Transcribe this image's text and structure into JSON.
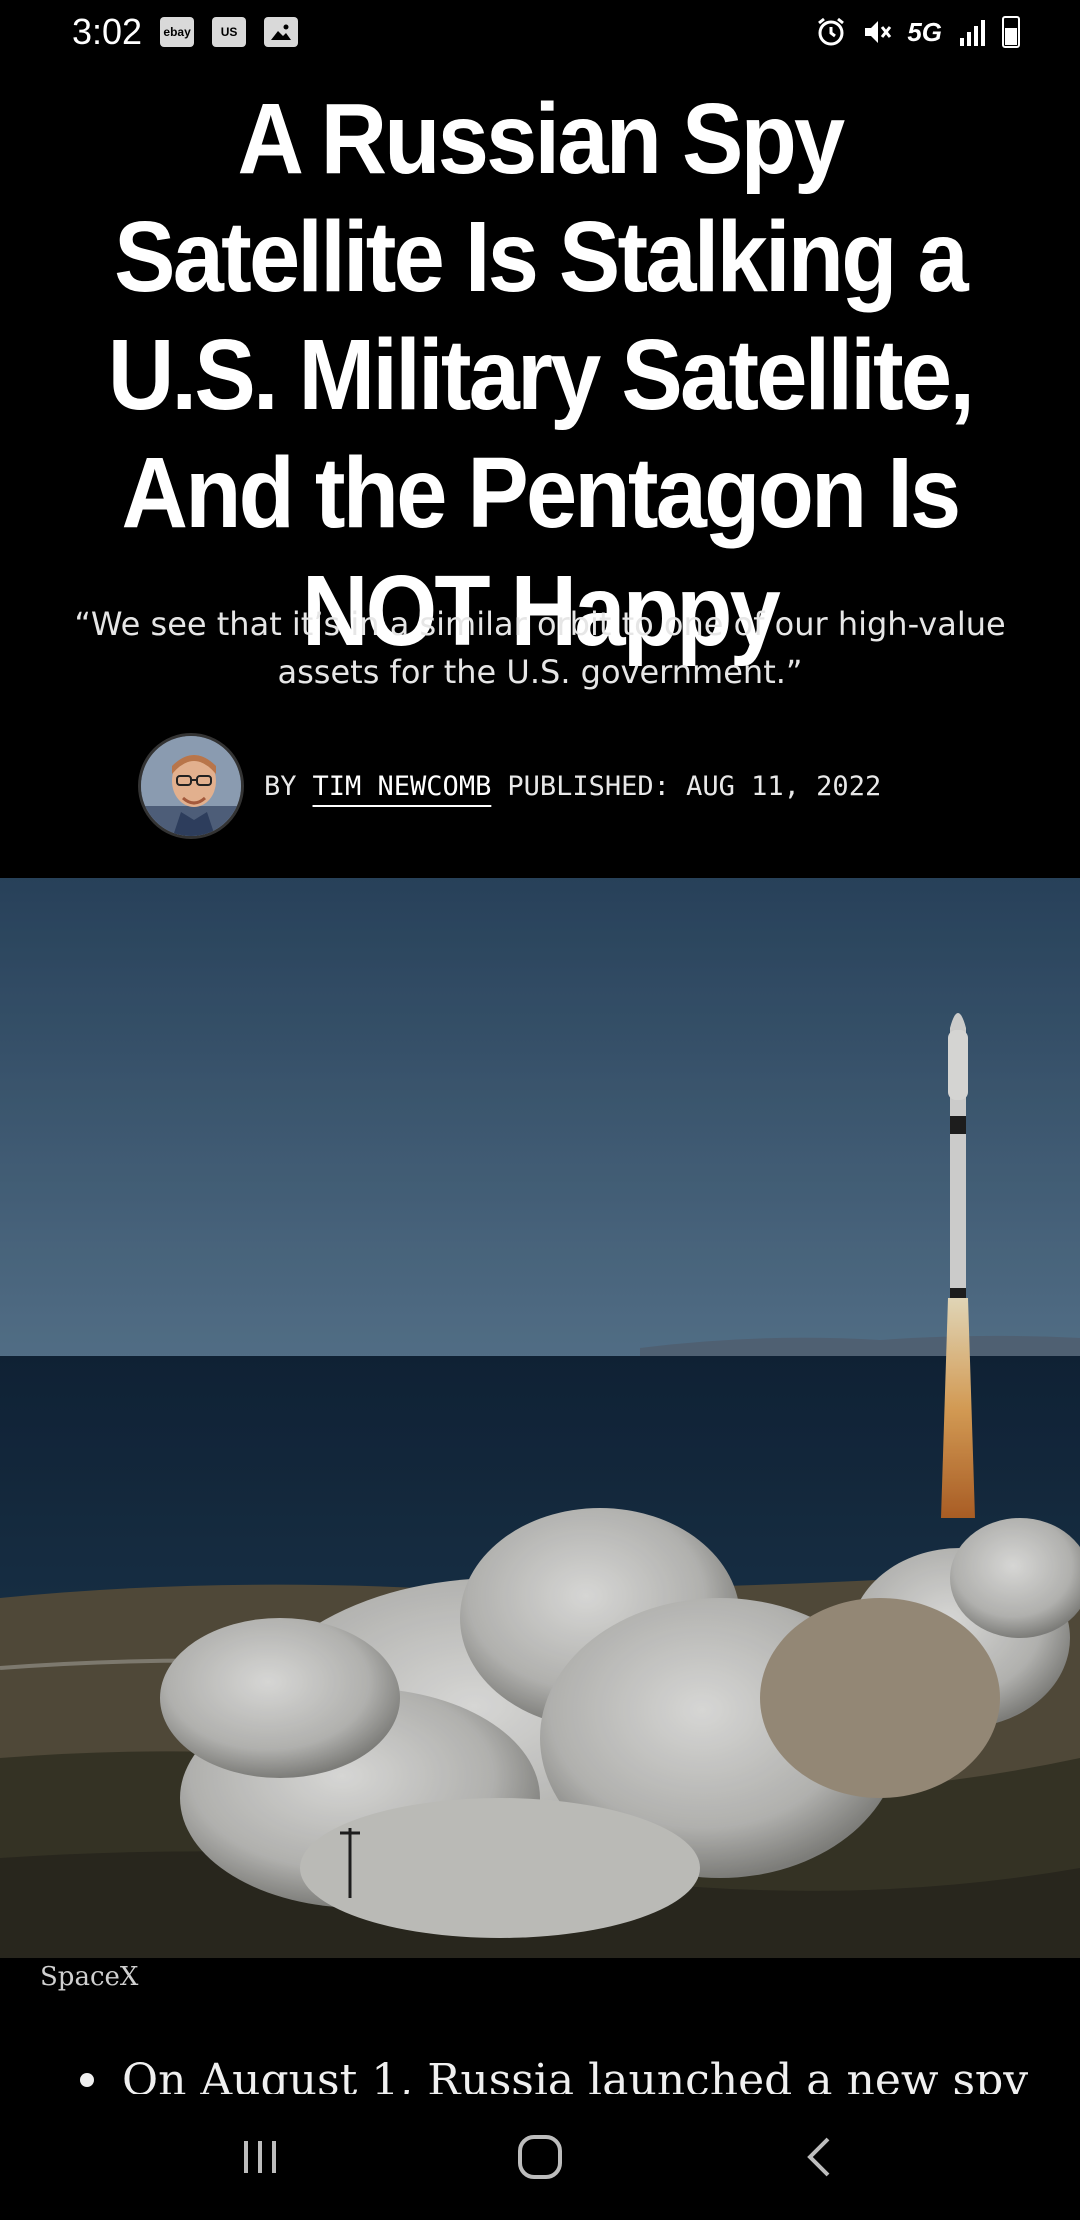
{
  "status_bar": {
    "time": "3:02",
    "notifications": [
      "ebay",
      "us",
      "image"
    ],
    "network": "5G",
    "icons": [
      "alarm-icon",
      "mute-icon",
      "signal-icon",
      "battery-icon"
    ]
  },
  "article": {
    "headline": "A Russian Spy Satellite Is Stalking a U.S. Military Satellite, And the Pentagon Is NOT Happy",
    "dek": "“We see that it’s in a similar orbit to one of our high-value assets for the U.S. government.”",
    "byline_prefix": "BY",
    "author": "TIM NEWCOMB",
    "published": "PUBLISHED: AUG 11, 2022",
    "image_caption": "SpaceX",
    "first_bullet": "On August 1, Russia launched a new spy"
  },
  "nav": {
    "buttons": [
      "recent-apps",
      "home",
      "back"
    ]
  },
  "colors": {
    "background": "#000000",
    "text": "#ffffff"
  }
}
